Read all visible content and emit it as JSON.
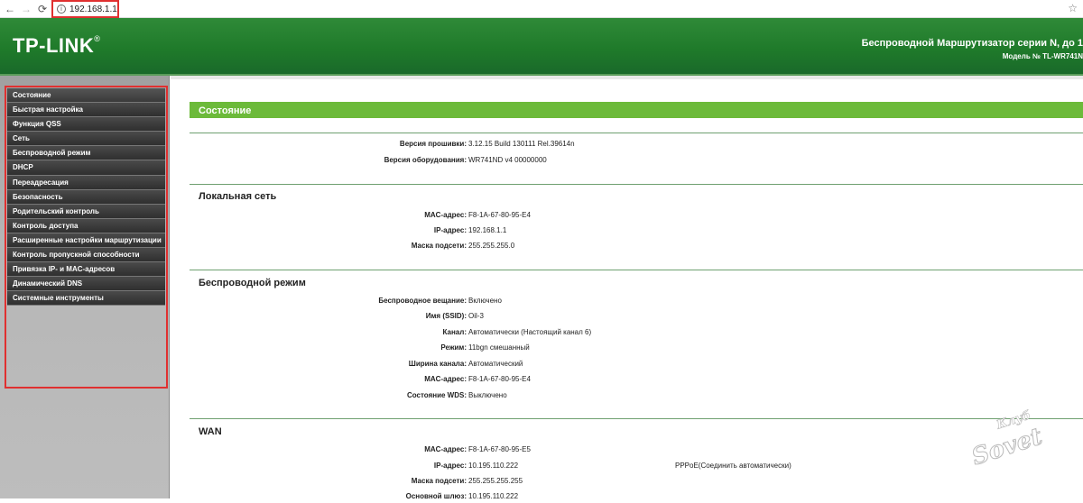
{
  "browser": {
    "url": "192.168.1.1"
  },
  "header": {
    "logo": "TP-LINK",
    "logo_reg": "®",
    "title": "Беспроводной Маршрутизатор серии N, до 1",
    "model": "Модель № TL-WR741N"
  },
  "sidebar": {
    "items": [
      {
        "label": "Состояние"
      },
      {
        "label": "Быстрая настройка"
      },
      {
        "label": "Функция QSS"
      },
      {
        "label": "Сеть"
      },
      {
        "label": "Беспроводной режим"
      },
      {
        "label": "DHCP"
      },
      {
        "label": "Переадресация"
      },
      {
        "label": "Безопасность"
      },
      {
        "label": "Родительский контроль"
      },
      {
        "label": "Контроль доступа"
      },
      {
        "label": "Расширенные настройки маршрутизации"
      },
      {
        "label": "Контроль пропускной способности"
      },
      {
        "label": "Привязка IP- и MAC-адресов"
      },
      {
        "label": "Динамический DNS"
      },
      {
        "label": "Системные инструменты"
      }
    ]
  },
  "main": {
    "status_title": "Состояние",
    "firmware": {
      "label": "Версия прошивки:",
      "value": "3.12.15 Build 130111 Rel.39614n"
    },
    "hardware": {
      "label": "Версия оборудования:",
      "value": "WR741ND v4 00000000"
    },
    "lan": {
      "title": "Локальная сеть",
      "mac": {
        "label": "MAC-адрес:",
        "value": "F8-1A-67-80-95-E4"
      },
      "ip": {
        "label": "IP-адрес:",
        "value": "192.168.1.1"
      },
      "mask": {
        "label": "Маска подсети:",
        "value": "255.255.255.0"
      }
    },
    "wireless": {
      "title": "Беспроводной режим",
      "broadcast": {
        "label": "Беспроводное вещание:",
        "value": "Включено"
      },
      "ssid": {
        "label": "Имя (SSID):",
        "value": "Oil-3"
      },
      "channel": {
        "label": "Канал:",
        "value": "Автоматически (Настоящий канал 6)"
      },
      "mode": {
        "label": "Режим:",
        "value": "11bgn смешанный"
      },
      "width": {
        "label": "Ширина канала:",
        "value": "Автоматический"
      },
      "mac": {
        "label": "MAC-адрес:",
        "value": "F8-1A-67-80-95-E4"
      },
      "wds": {
        "label": "Состояние WDS:",
        "value": "Выключено"
      }
    },
    "wan": {
      "title": "WAN",
      "mac": {
        "label": "MAC-адрес:",
        "value": "F8-1A-67-80-95-E5"
      },
      "ip": {
        "label": "IP-адрес:",
        "value": "10.195.110.222",
        "extra": "PPPoE(Соединить автоматически)"
      },
      "mask": {
        "label": "Маска подсети:",
        "value": "255.255.255.255"
      },
      "gateway": {
        "label": "Основной шлюз:",
        "value": "10.195.110.222"
      }
    }
  },
  "watermark": {
    "top": "Клуб",
    "bottom": "Sovet"
  },
  "colors": {
    "header_green": "#1f7a2a",
    "status_green": "#6cba3a",
    "menu_dark": "#3a3a3a",
    "highlight_red": "#e03030"
  }
}
